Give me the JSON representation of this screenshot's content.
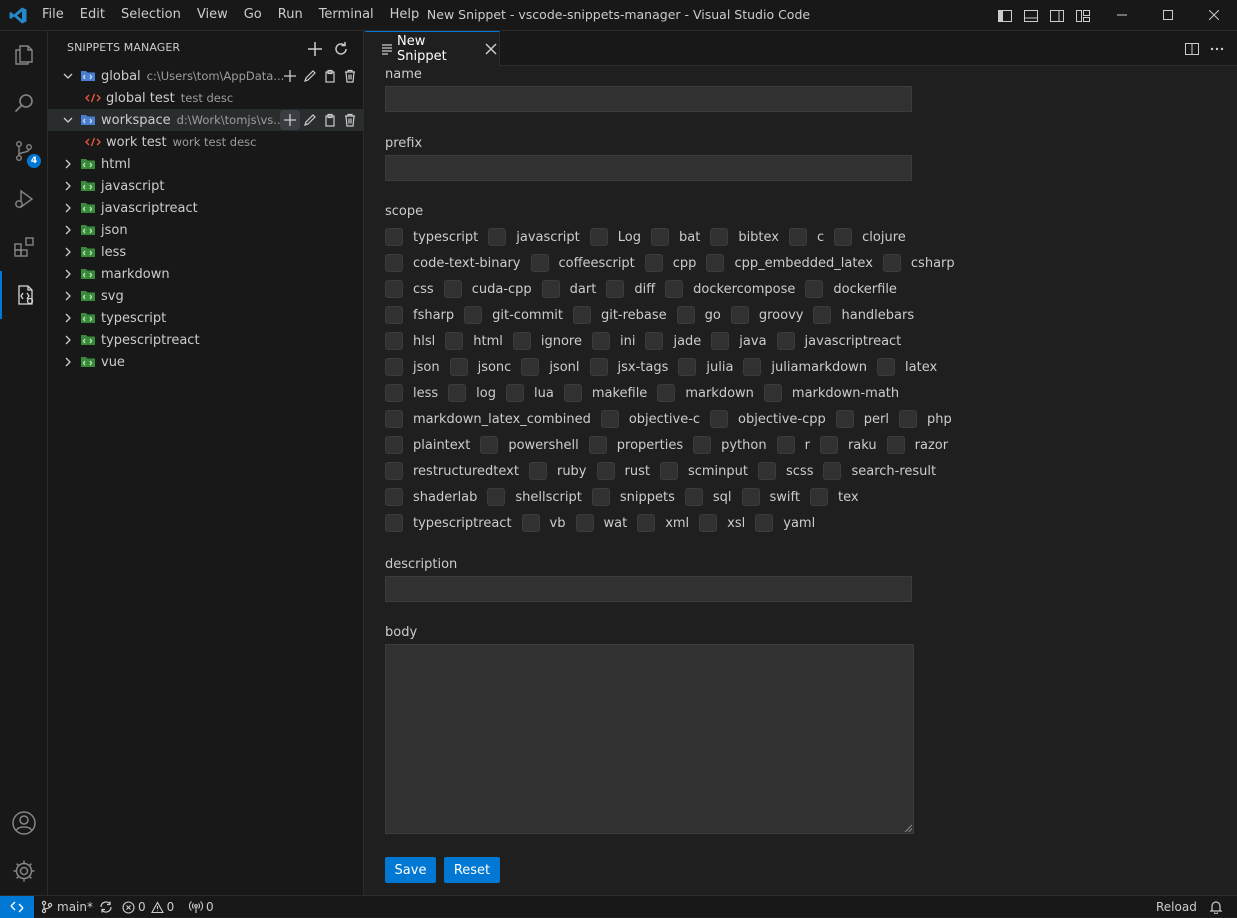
{
  "menu": [
    "File",
    "Edit",
    "Selection",
    "View",
    "Go",
    "Run",
    "Terminal",
    "Help"
  ],
  "window_title": "New Snippet - vscode-snippets-manager - Visual Studio Code",
  "activity": {
    "source_control_badge": "4"
  },
  "sidebar": {
    "title": "SNIPPETS MANAGER",
    "tree": [
      {
        "label": "global",
        "desc": "c:\\Users\\tom\\AppData...",
        "children": [
          {
            "label": "global test",
            "desc": "test desc"
          }
        ]
      },
      {
        "label": "workspace",
        "desc": "d:\\Work\\tomjs\\vs...",
        "children": [
          {
            "label": "work test",
            "desc": "work test desc"
          }
        ]
      },
      {
        "label": "html"
      },
      {
        "label": "javascript"
      },
      {
        "label": "javascriptreact"
      },
      {
        "label": "json"
      },
      {
        "label": "less"
      },
      {
        "label": "markdown"
      },
      {
        "label": "svg"
      },
      {
        "label": "typescript"
      },
      {
        "label": "typescriptreact"
      },
      {
        "label": "vue"
      }
    ]
  },
  "tab": {
    "label": "New Snippet"
  },
  "form": {
    "name_label": "name",
    "prefix_label": "prefix",
    "scope_label": "scope",
    "description_label": "description",
    "body_label": "body",
    "scopes": [
      [
        "typescript",
        "javascript",
        "Log",
        "bat",
        "bibtex",
        "c",
        "clojure"
      ],
      [
        "code-text-binary",
        "coffeescript",
        "cpp",
        "cpp_embedded_latex",
        "csharp"
      ],
      [
        "css",
        "cuda-cpp",
        "dart",
        "diff",
        "dockercompose",
        "dockerfile"
      ],
      [
        "fsharp",
        "git-commit",
        "git-rebase",
        "go",
        "groovy",
        "handlebars"
      ],
      [
        "hlsl",
        "html",
        "ignore",
        "ini",
        "jade",
        "java",
        "javascriptreact"
      ],
      [
        "json",
        "jsonc",
        "jsonl",
        "jsx-tags",
        "julia",
        "juliamarkdown",
        "latex"
      ],
      [
        "less",
        "log",
        "lua",
        "makefile",
        "markdown",
        "markdown-math"
      ],
      [
        "markdown_latex_combined",
        "objective-c",
        "objective-cpp",
        "perl",
        "php"
      ],
      [
        "plaintext",
        "powershell",
        "properties",
        "python",
        "r",
        "raku",
        "razor"
      ],
      [
        "restructuredtext",
        "ruby",
        "rust",
        "scminput",
        "scss",
        "search-result"
      ],
      [
        "shaderlab",
        "shellscript",
        "snippets",
        "sql",
        "swift",
        "tex"
      ],
      [
        "typescriptreact",
        "vb",
        "wat",
        "xml",
        "xsl",
        "yaml"
      ]
    ],
    "save_label": "Save",
    "reset_label": "Reset"
  },
  "statusbar": {
    "branch": "main*",
    "errors": "0",
    "warnings": "0",
    "ports": "0",
    "reload": "Reload"
  },
  "colors": {
    "accent": "#0078d4",
    "background": "#1f1f1f",
    "sidebar": "#181818",
    "snippet_icon": "#e2583e",
    "folder_icon": "#3ea84a"
  }
}
